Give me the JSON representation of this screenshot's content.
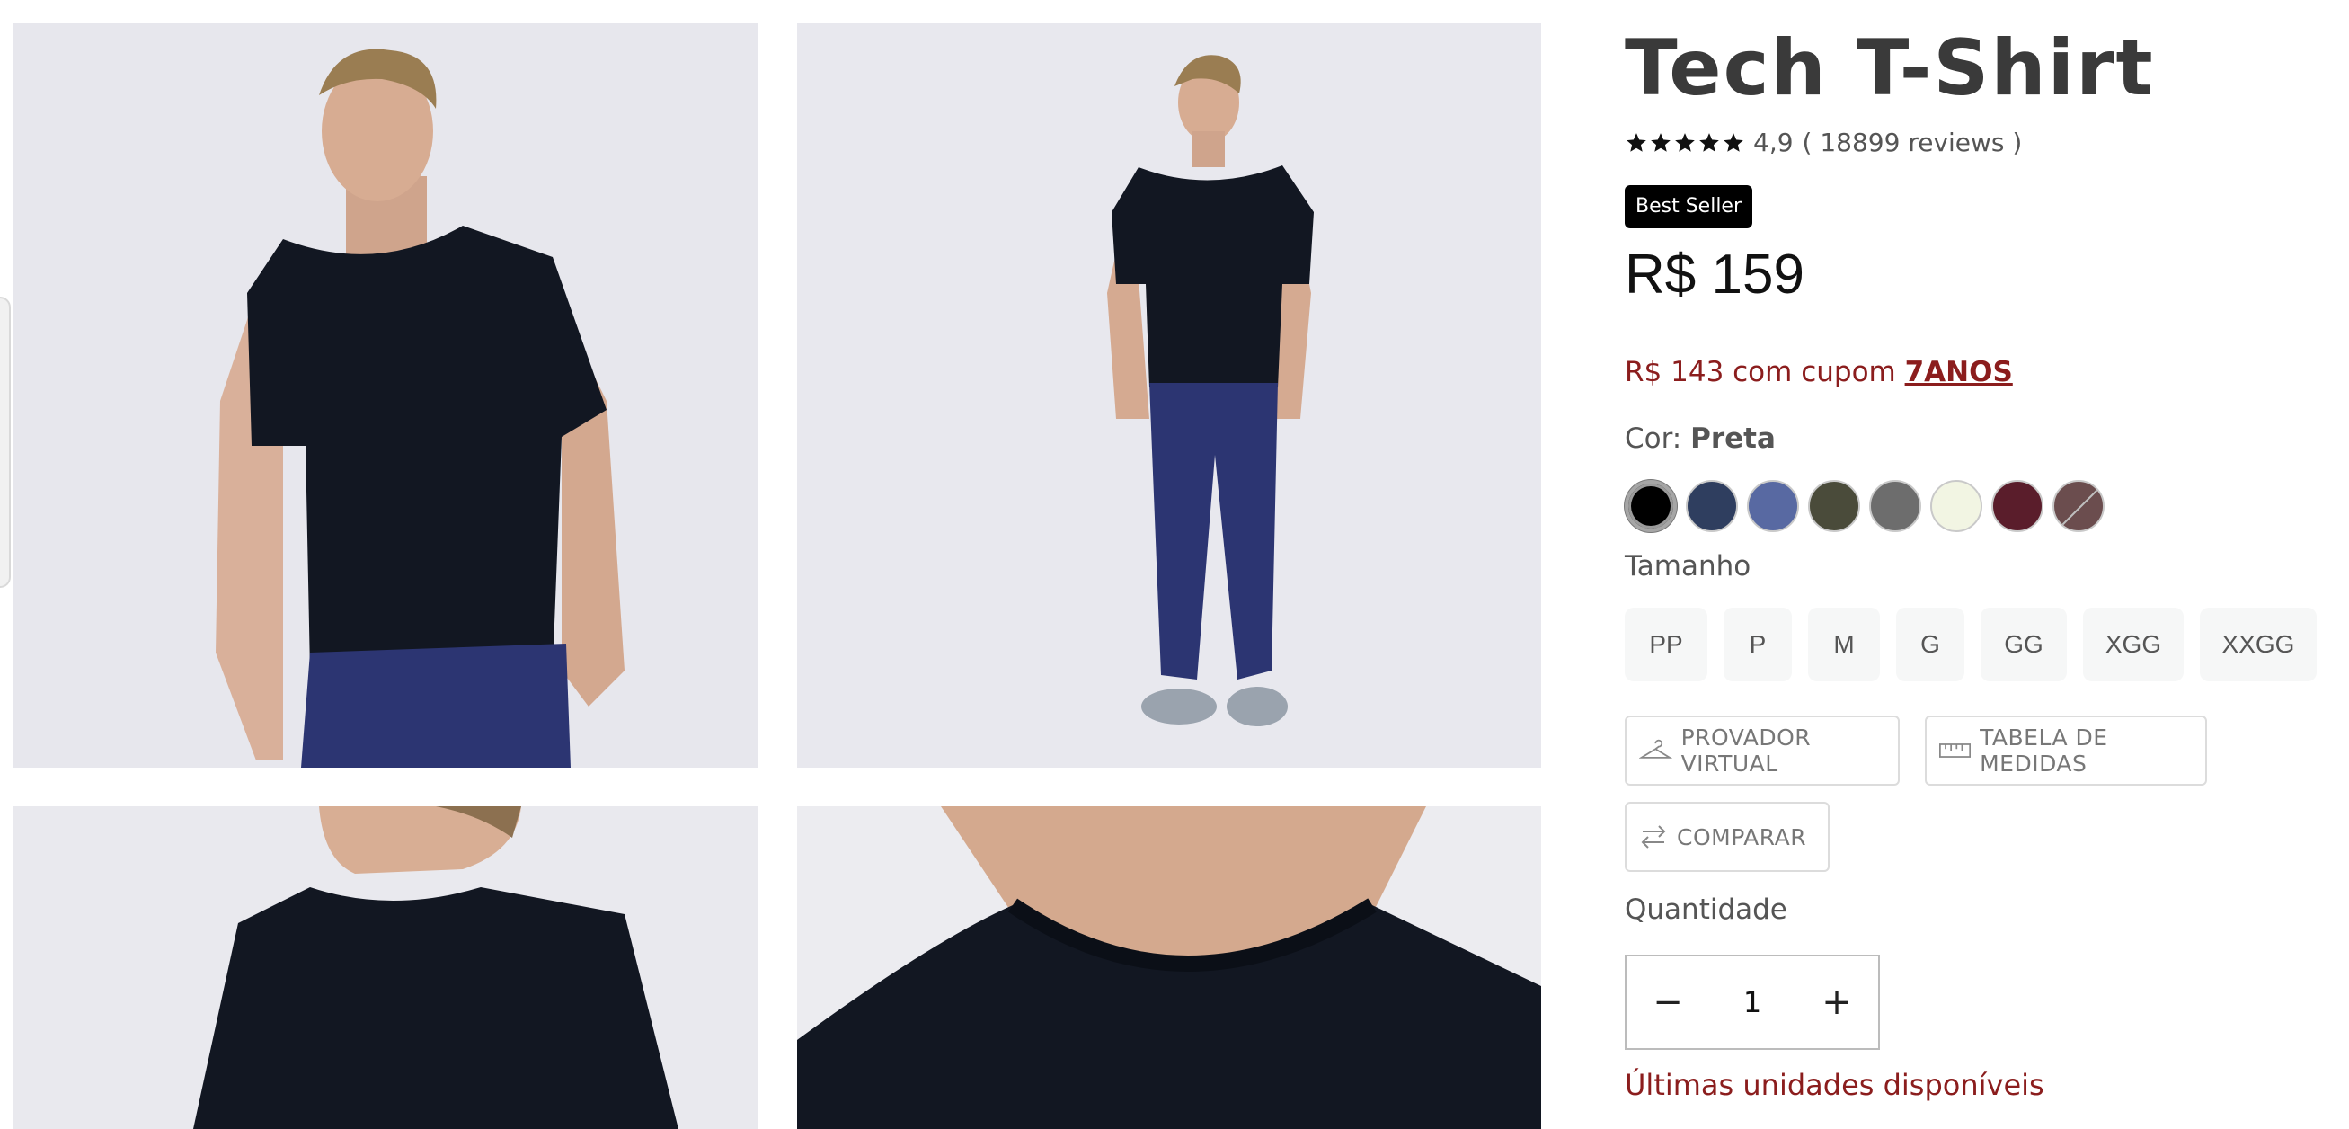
{
  "product": {
    "title": "Tech T-Shirt",
    "rating": "4,9",
    "rating_stars": 5,
    "reviews": "( 18899 reviews )",
    "badge": "Best Seller",
    "price": "R$ 159",
    "coupon_text": "R$ 143 com cupom ",
    "coupon_code": "7ANOS"
  },
  "color": {
    "label": "Cor: ",
    "selected": "Preta",
    "swatches": [
      "#000000",
      "#2f3e5f",
      "#5869a2",
      "#4a4b3a",
      "#6d6d6d",
      "#f2f5e3",
      "#5a1d2b",
      "#6b4d4e"
    ]
  },
  "size": {
    "label": "Tamanho",
    "options": [
      "PP",
      "P",
      "M",
      "G",
      "GG",
      "XGG",
      "XXGG"
    ]
  },
  "actions": {
    "virtual_fitting": "PROVADOR VIRTUAL",
    "size_table": "TABELA DE MEDIDAS",
    "compare": "COMPARAR"
  },
  "quantity": {
    "label": "Quantidade",
    "value": "1",
    "decrement": "−",
    "increment": "+"
  },
  "stock_message": "Últimas unidades disponíveis",
  "colors": {
    "accent_red": "#8b1d1d",
    "badge_bg": "#000000",
    "shirt": "#121722",
    "pants": "#2c3572"
  }
}
